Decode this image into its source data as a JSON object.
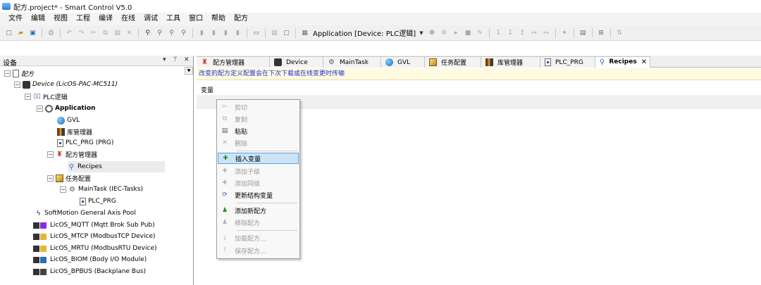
{
  "window": {
    "title": "配方.project* - Smart Control V5.0"
  },
  "menu": [
    "文件",
    "编辑",
    "视图",
    "工程",
    "编译",
    "在线",
    "调试",
    "工具",
    "窗口",
    "帮助",
    "配方"
  ],
  "toolbar": {
    "application_label": "Application [Device: PLC逻辑]"
  },
  "left_pane": {
    "title": "设备",
    "controls": {
      "dropdown": "▾",
      "pin": "ᛘ",
      "close": "✕"
    },
    "tree": {
      "root": "配方",
      "device": "Device (LicOS-PAC-MC511)",
      "plc_logic": "PLC逻辑",
      "application": "Application",
      "gvl": "GVL",
      "library_manager": "库管理器",
      "plc_prg": "PLC_PRG (PRG)",
      "recipe_manager": "配方管理器",
      "recipes": "Recipes",
      "task_config": "任务配置",
      "main_task": "MainTask (IEC-Tasks)",
      "main_task_prg": "PLC_PRG",
      "softmotion": "SoftMotion General Axis Pool",
      "modules": [
        "LicOS_MQTT (Mqtt Brok Sub Pub)",
        "LicOS_MTCP (ModbusTCP Device)",
        "LicOS_MRTU (ModbusRTU Device)",
        "LicOS_BIOM (Body I/O Module)",
        "LicOS_BPBUS (Backplane Bus)"
      ]
    }
  },
  "tabs": [
    {
      "label": "配方管理器",
      "icon": "recipe-icon"
    },
    {
      "label": "Device",
      "icon": "device-icon"
    },
    {
      "label": "MainTask",
      "icon": "task-icon"
    },
    {
      "label": "GVL",
      "icon": "globe-icon"
    },
    {
      "label": "任务配置",
      "icon": "task-config-icon"
    },
    {
      "label": "库管理器",
      "icon": "library-icon"
    },
    {
      "label": "PLC_PRG",
      "icon": "pou-icon"
    },
    {
      "label": "Recipes",
      "icon": "recipes-icon",
      "active": true,
      "close": "✕"
    }
  ],
  "editor": {
    "banner": "改变的配方定义配置会在下次下载或在线变更时传输",
    "column_header": "变量"
  },
  "context_menu": {
    "items": [
      {
        "label": "剪切",
        "enabled": false,
        "icon": "cut-icon"
      },
      {
        "label": "复制",
        "enabled": false,
        "icon": "copy-icon"
      },
      {
        "label": "粘贴",
        "enabled": true,
        "icon": "paste-icon"
      },
      {
        "label": "删除",
        "enabled": false,
        "icon": "delete-icon"
      },
      {
        "label": "插入变量",
        "enabled": true,
        "highlighted": true,
        "icon": "insert-variable-icon"
      },
      {
        "label": "添加子级",
        "enabled": false,
        "icon": "add-child-icon"
      },
      {
        "label": "添加同级",
        "enabled": false,
        "icon": "add-sibling-icon"
      },
      {
        "label": "更新结构变量",
        "enabled": true,
        "icon": "update-struct-icon"
      },
      {
        "label": "添加新配方",
        "enabled": true,
        "icon": "add-recipe-icon"
      },
      {
        "label": "移除配方",
        "enabled": false,
        "icon": "remove-recipe-icon"
      },
      {
        "label": "加载配方...",
        "enabled": false,
        "icon": "load-recipe-icon"
      },
      {
        "label": "保存配方...",
        "enabled": false,
        "icon": "save-recipe-icon"
      }
    ]
  },
  "colors": {
    "banner_text": "#1c2fd0",
    "banner_bg": "#fffbe0",
    "highlight": "#cce4f7",
    "highlight_border": "#5aa2e0"
  }
}
